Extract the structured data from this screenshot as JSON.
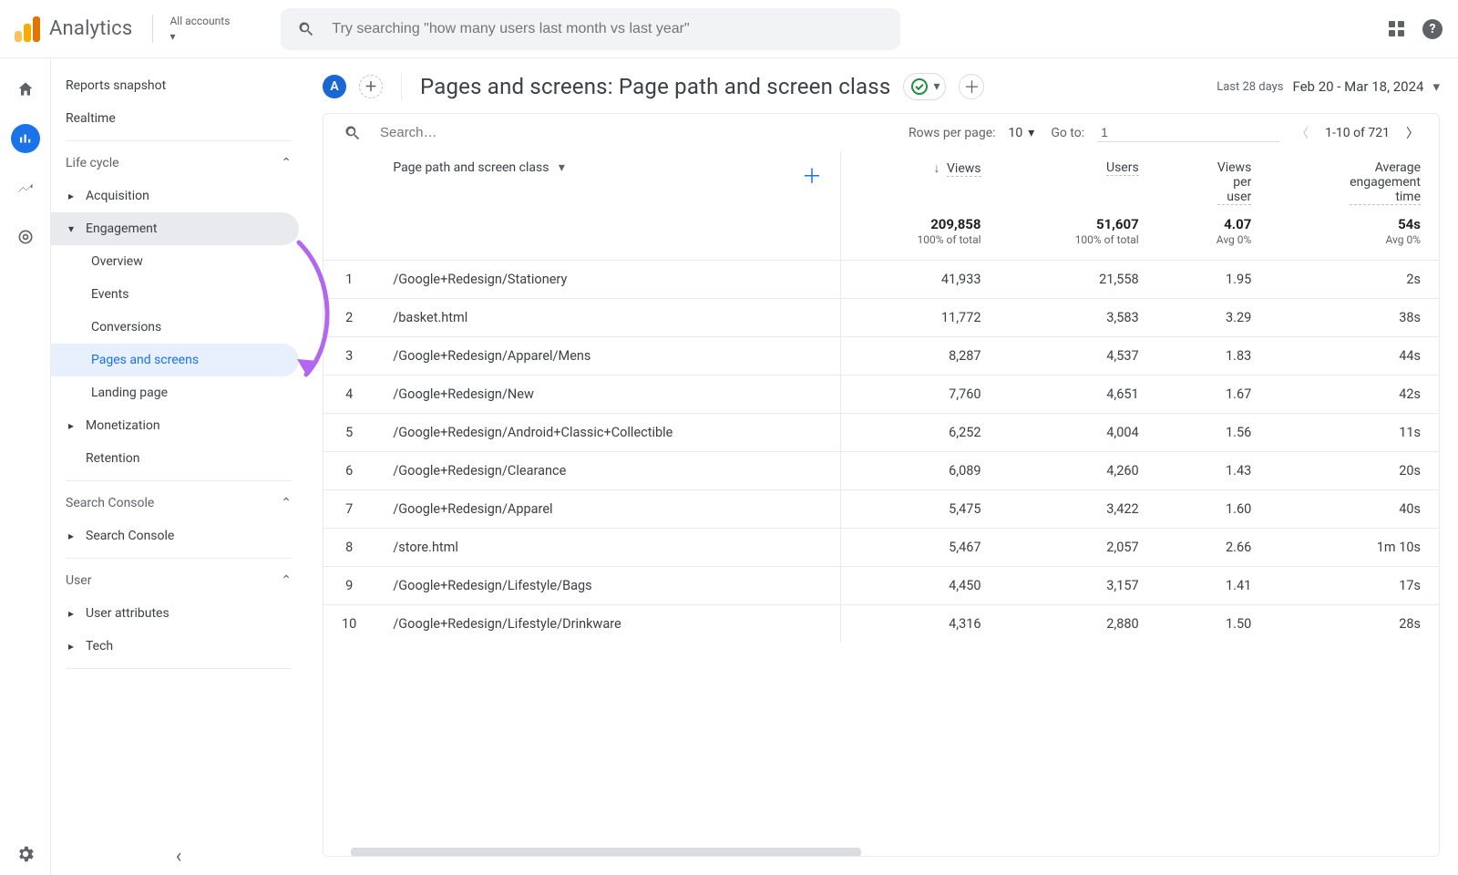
{
  "brand": "Analytics",
  "accounts_label": "All accounts",
  "search_placeholder": "Try searching \"how many users last month vs last year\"",
  "sidebar": {
    "snapshot": "Reports snapshot",
    "realtime": "Realtime",
    "lifecycle": "Life cycle",
    "acquisition": "Acquisition",
    "engagement": "Engagement",
    "engagement_items": {
      "overview": "Overview",
      "events": "Events",
      "conversions": "Conversions",
      "pages": "Pages and screens",
      "landing": "Landing page"
    },
    "monetization": "Monetization",
    "retention": "Retention",
    "search_console_group": "Search Console",
    "search_console_item": "Search Console",
    "user_group": "User",
    "user_attributes": "User attributes",
    "tech": "Tech"
  },
  "page": {
    "chip": "A",
    "title": "Pages and screens: Page path and screen class",
    "date_label": "Last 28 days",
    "date_range": "Feb 20 - Mar 18, 2024"
  },
  "toolbar": {
    "search_placeholder": "Search…",
    "rows_label": "Rows per page:",
    "rows_value": "10",
    "goto_label": "Go to:",
    "goto_value": "1",
    "range": "1-10 of 721"
  },
  "columns": {
    "dimension": "Page path and screen class",
    "views": "Views",
    "users": "Users",
    "vpu1": "Views",
    "vpu2": "per",
    "vpu3": "user",
    "aet1": "Average",
    "aet2": "engagement",
    "aet3": "time"
  },
  "totals": {
    "views": "209,858",
    "views_sub": "100% of total",
    "users": "51,607",
    "users_sub": "100% of total",
    "vpu": "4.07",
    "vpu_sub": "Avg 0%",
    "aet": "54s",
    "aet_sub": "Avg 0%"
  },
  "rows": [
    {
      "i": "1",
      "path": "/Google+Redesign/Stationery",
      "views": "41,933",
      "users": "21,558",
      "vpu": "1.95",
      "aet": "2s"
    },
    {
      "i": "2",
      "path": "/basket.html",
      "views": "11,772",
      "users": "3,583",
      "vpu": "3.29",
      "aet": "38s"
    },
    {
      "i": "3",
      "path": "/Google+Redesign/Apparel/Mens",
      "views": "8,287",
      "users": "4,537",
      "vpu": "1.83",
      "aet": "44s"
    },
    {
      "i": "4",
      "path": "/Google+Redesign/New",
      "views": "7,760",
      "users": "4,651",
      "vpu": "1.67",
      "aet": "42s"
    },
    {
      "i": "5",
      "path": "/Google+Redesign/Android+Classic+Collectible",
      "views": "6,252",
      "users": "4,004",
      "vpu": "1.56",
      "aet": "11s"
    },
    {
      "i": "6",
      "path": "/Google+Redesign/Clearance",
      "views": "6,089",
      "users": "4,260",
      "vpu": "1.43",
      "aet": "20s"
    },
    {
      "i": "7",
      "path": "/Google+Redesign/Apparel",
      "views": "5,475",
      "users": "3,422",
      "vpu": "1.60",
      "aet": "40s"
    },
    {
      "i": "8",
      "path": "/store.html",
      "views": "5,467",
      "users": "2,057",
      "vpu": "2.66",
      "aet": "1m 10s"
    },
    {
      "i": "9",
      "path": "/Google+Redesign/Lifestyle/Bags",
      "views": "4,450",
      "users": "3,157",
      "vpu": "1.41",
      "aet": "17s"
    },
    {
      "i": "10",
      "path": "/Google+Redesign/Lifestyle/Drinkware",
      "views": "4,316",
      "users": "2,880",
      "vpu": "1.50",
      "aet": "28s"
    }
  ]
}
